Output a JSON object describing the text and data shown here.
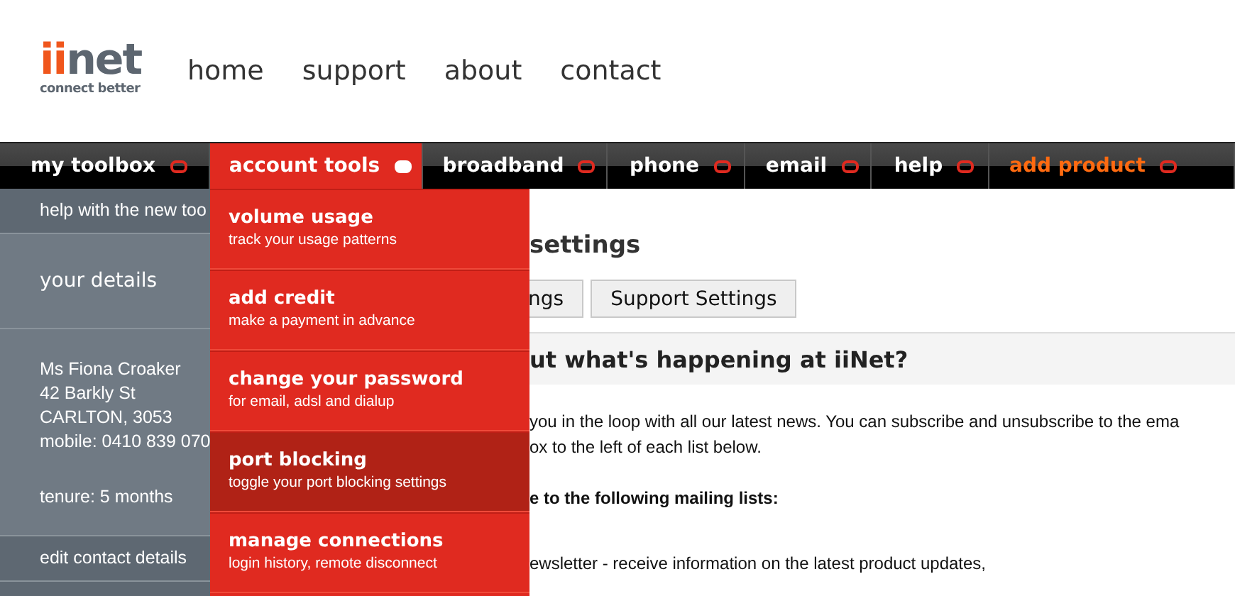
{
  "header": {
    "logo": {
      "accent": "ii",
      "main": "net",
      "tagline": "connect better"
    },
    "nav": [
      "home",
      "support",
      "about",
      "contact"
    ]
  },
  "navbar": {
    "tabs": [
      {
        "label": "my toolbox",
        "selected": false,
        "kind": "normal"
      },
      {
        "label": "account tools",
        "selected": true,
        "kind": "normal"
      },
      {
        "label": "broadband",
        "selected": false,
        "kind": "normal"
      },
      {
        "label": "phone",
        "selected": false,
        "kind": "normal"
      },
      {
        "label": "email",
        "selected": false,
        "kind": "normal"
      },
      {
        "label": "help",
        "selected": false,
        "kind": "normal"
      },
      {
        "label": "add product",
        "selected": false,
        "kind": "promo"
      }
    ]
  },
  "sidebar": {
    "help_link": "help with the new too",
    "section_title": "your details",
    "details": [
      "Ms Fiona Croaker",
      "42 Barkly St",
      "CARLTON, 3053",
      "mobile: 0410 839 070"
    ],
    "tenure": "tenure: 5 months",
    "edit_link": "edit contact details"
  },
  "dropdown": {
    "items": [
      {
        "title": "volume usage",
        "subtitle": "track your usage patterns",
        "selected": false
      },
      {
        "title": "add credit",
        "subtitle": "make a payment in advance",
        "selected": false
      },
      {
        "title": "change your password",
        "subtitle": "for email, adsl and dialup",
        "selected": false
      },
      {
        "title": "port blocking",
        "subtitle": "toggle your port blocking settings",
        "selected": true
      },
      {
        "title": "manage connections",
        "subtitle": "login history, remote disconnect",
        "selected": false
      }
    ]
  },
  "content": {
    "heading": "settings",
    "buttons": [
      "ngs",
      "Support Settings"
    ],
    "section_heading": "ut what's happening at iiNet?",
    "paragraph": [
      "you in the loop with all our latest news. You can subscribe and unsubscribe to the ema",
      "ox to the left of each list below."
    ],
    "subheading": "e to the following mailing lists:",
    "list_item": "ewsletter - receive information on the latest product updates,"
  }
}
